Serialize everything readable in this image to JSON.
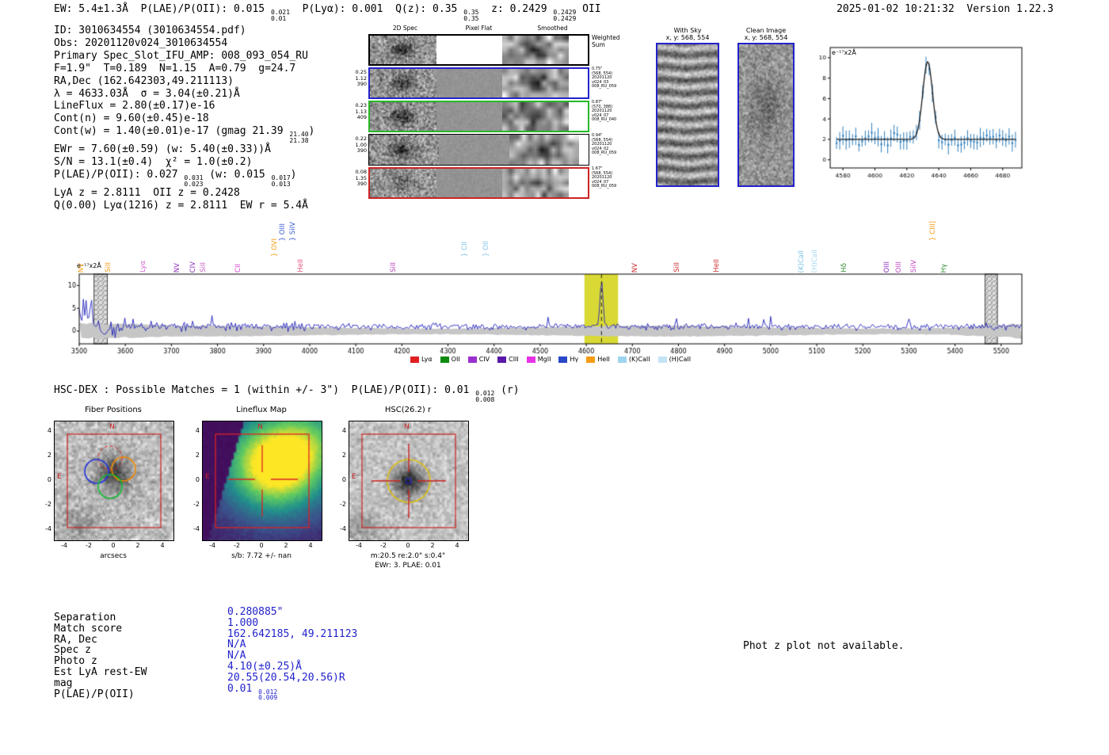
{
  "header": {
    "summary_line": "EW: 5.4±1.3Å  P(LAE)/P(OII): 0.015 {0.021|0.01}  P(Lyα): 0.001  Q(z): 0.35 {0.35|0.35}  z: 0.2429 {0.2429|0.2429} OII",
    "timestamp": "2025-01-02 10:21:32  Version 1.22.3"
  },
  "info_block": {
    "lines": [
      "ID: 3010634554 (3010634554.pdf)",
      "Obs: 20201120v024_3010634554",
      "Primary Spec_Slot_IFU_AMP: 008_093_054_RU",
      "F=1.9\"  T=0.189  N=1.15  A=0.79  g=24.7",
      "RA,Dec (162.642303,49.211113)",
      "λ = 4633.03Å  σ = 3.04(±0.21)Å",
      "LineFlux = 2.80(±0.17)e-16",
      "Cont(n) = 9.60(±0.45)e-18",
      "Cont(w) = 1.40(±0.01)e-17 (gmag 21.39 {21.40|21.38})",
      "EWr = 7.60(±0.59) (w: 5.40(±0.33))Å",
      "S/N = 13.1(±0.4)  χ² = 1.0(±0.2)",
      "P(LAE)/P(OII): 0.027 {0.031|0.023} (w: 0.015 {0.017|0.013})",
      "LyA z = 2.8111  OII z = 0.2428",
      "Q(0.00) Lyα(1216) z = 2.8111  EW r = 5.4Å"
    ]
  },
  "cutout_grid": {
    "column_titles": [
      "2D Spec",
      "Pixel Flat",
      "Smoothed"
    ],
    "rows": [
      {
        "left_values": [],
        "right_lines": [
          "Weighted",
          "Sum"
        ],
        "border": "#000000",
        "bw": 2
      },
      {
        "left_values": [
          "0.25",
          "1.12",
          "390"
        ],
        "right_lines": [
          "0.75\"",
          "(568, 554)",
          "20201120",
          "v024_03",
          "008_RU_059"
        ],
        "border": "#2323cc",
        "bw": 2
      },
      {
        "left_values": [
          "0.23",
          "1.13",
          "409"
        ],
        "right_lines": [
          "0.87\"",
          "(570, 388)",
          "20201120",
          "v024_07",
          "008_RU_040"
        ],
        "border": "#28b828",
        "bw": 2
      },
      {
        "left_values": [
          "0.22",
          "1.00",
          "390"
        ],
        "right_lines": [
          "0.94\"",
          "(568, 554)",
          "20201120",
          "v024_02",
          "008_RU_059"
        ],
        "border": "#000000",
        "bw": 1
      },
      {
        "left_values": [
          "0.08",
          "1.35",
          "390"
        ],
        "right_lines": [
          "1.67\"",
          "(568, 554)",
          "20201120",
          "v024_07",
          "008_RU_059"
        ],
        "border": "#cc2323",
        "bw": 2
      }
    ]
  },
  "sky_panels": [
    {
      "title": "With Sky",
      "subtitle": "x, y: 568, 554"
    },
    {
      "title": "Clean Image",
      "subtitle": "x, y: 568, 554"
    }
  ],
  "chart_data": [
    {
      "id": "line_fit_zoom",
      "type": "scatter",
      "ylabel_note": "e⁻¹⁷x2Å",
      "xlim": [
        4572,
        4692
      ],
      "ylim": [
        -0.8,
        11
      ],
      "xticks": [
        4580,
        4600,
        4620,
        4640,
        4660,
        4680
      ],
      "yticks": [
        0,
        2,
        4,
        6,
        8,
        10
      ],
      "fit": {
        "center": 4633.03,
        "sigma": 3.04,
        "amplitude": 7.6,
        "continuum": 2.0,
        "peak_value": 9.6
      },
      "point_color": "#2e7ebc",
      "fit_color": "#1a1a1a",
      "point_step": 2,
      "error_bar": 0.75
    },
    {
      "id": "full_spectrum",
      "type": "line",
      "ylabel_note": "e⁻¹⁷x2Å",
      "xlim": [
        3500,
        5545
      ],
      "ylim": [
        -2.8,
        12.5
      ],
      "xticks": [
        3500,
        3600,
        3700,
        3800,
        3900,
        4000,
        4100,
        4200,
        4300,
        4400,
        4500,
        4600,
        4700,
        4800,
        4900,
        5000,
        5100,
        5200,
        5300,
        5400,
        5500
      ],
      "yticks": [
        0,
        5,
        10
      ],
      "line_color": "#2121bb",
      "continuum": 0.95,
      "noise_sigma": 0.62,
      "blue_end_noise_sigma": 1.9,
      "emission_line": {
        "center": 4633.03,
        "amplitude": 10.2,
        "sigma": 3.2
      },
      "highlight_band": {
        "x0": 4596,
        "x1": 4669,
        "color": "#d7d72a"
      },
      "dashed_marker_x": 4633.03,
      "hatch_bands": [
        [
          3532,
          3561
        ],
        [
          5465,
          5492
        ]
      ],
      "error_band_halfwidth": 1.0,
      "line_markers": [
        {
          "label": "NV",
          "x": 3506,
          "color": "#f59b14",
          "tier": 0
        },
        {
          "label": "SiII",
          "x": 3563,
          "color": "#f59b14",
          "tier": 0
        },
        {
          "label": "Lyα",
          "x": 3640,
          "color": "#d65fd6",
          "tier": 0
        },
        {
          "label": "NV",
          "x": 3713,
          "color": "#8f2fbf",
          "tier": 0
        },
        {
          "label": "CIV",
          "x": 3747,
          "color": "#8f2fbf",
          "tier": 0
        },
        {
          "label": "SiII",
          "x": 3769,
          "color": "#c45fc4",
          "tier": 0
        },
        {
          "label": "CII",
          "x": 3846,
          "color": "#d643d6",
          "tier": 0
        },
        {
          "label": "} OVI",
          "x": 3924,
          "color": "#f59b14",
          "tier": 1
        },
        {
          "label": "} OIII",
          "x": 3942,
          "color": "#3b5bd6",
          "tier": 2
        },
        {
          "label": "} SiIV",
          "x": 3964,
          "color": "#3b5bd6",
          "tier": 2
        },
        {
          "label": "HeII",
          "x": 3981,
          "color": "#e0507a",
          "tier": 0
        },
        {
          "label": "SiII",
          "x": 4183,
          "color": "#b845b8",
          "tier": 0
        },
        {
          "label": "} CII",
          "x": 4337,
          "color": "#7fc4e8",
          "tier": 1
        },
        {
          "label": "} OII",
          "x": 4383,
          "color": "#7fc4e8",
          "tier": 1
        },
        {
          "label": "NV",
          "x": 4706,
          "color": "#cc2b2b",
          "tier": 0
        },
        {
          "label": "SiII",
          "x": 4798,
          "color": "#cc2b2b",
          "tier": 0
        },
        {
          "label": "HeII",
          "x": 4884,
          "color": "#cc2b2b",
          "tier": 0
        },
        {
          "label": "(K)CaII",
          "x": 5068,
          "color": "#7fc4e8",
          "tier": 0
        },
        {
          "label": "(H)CaII",
          "x": 5096,
          "color": "#a8d8ee",
          "tier": 0
        },
        {
          "label": "Hδ",
          "x": 5160,
          "color": "#2e8b2e",
          "tier": 0
        },
        {
          "label": "OIII",
          "x": 5253,
          "color": "#8f2fbf",
          "tier": 0
        },
        {
          "label": "OIII",
          "x": 5278,
          "color": "#c445c4",
          "tier": 0
        },
        {
          "label": "SiIV",
          "x": 5312,
          "color": "#c445c4",
          "tier": 0
        },
        {
          "label": "} CIII]",
          "x": 5352,
          "color": "#f59b14",
          "tier": 2
        },
        {
          "label": "Hγ",
          "x": 5376,
          "color": "#2e8b2e",
          "tier": 0
        }
      ],
      "legend": [
        {
          "label": "Lyα",
          "color": "#e02020"
        },
        {
          "label": "OII",
          "color": "#0f8a0f"
        },
        {
          "label": "CIV",
          "color": "#9a30d0"
        },
        {
          "label": "CIII",
          "color": "#5a18a8"
        },
        {
          "label": "MgII",
          "color": "#e832e8"
        },
        {
          "label": "Hγ",
          "color": "#2848c8"
        },
        {
          "label": "HeII",
          "color": "#f59b14"
        },
        {
          "label": "(K)CaII",
          "color": "#9fd4ef"
        },
        {
          "label": "(H)CaII",
          "color": "#c4e4f4"
        }
      ]
    }
  ],
  "hsc_section": {
    "header": "HSC-DEX : Possible Matches = 1 (within +/- 3\")  P(LAE)/P(OII): 0.01 {0.012|0.008} (r)",
    "axis_ticks": [
      -4,
      -2,
      0,
      2,
      4
    ],
    "compass": {
      "n": "N",
      "e": "E"
    },
    "panels": [
      {
        "title": "Fiber Positions",
        "xlabel": "arcsecs",
        "xlabel2": ""
      },
      {
        "title": "Lineflux Map",
        "xlabel": "s/b: 7.72 +/- nan",
        "xlabel2": ""
      },
      {
        "title": "HSC(26.2) r",
        "xlabel": "m:20.5 re:2.0\" s:0.4\"",
        "xlabel2": "EWr: 3. PLAE: 0.01"
      }
    ]
  },
  "match_table": {
    "value_color": "#2222cc",
    "rows": [
      {
        "label": "Separation",
        "value": "0.280885\""
      },
      {
        "label": "Match score",
        "value": "1.000"
      },
      {
        "label": "RA, Dec",
        "value": "162.642185, 49.211123"
      },
      {
        "label": "Spec z",
        "value": "N/A"
      },
      {
        "label": "Photo z",
        "value": "N/A"
      },
      {
        "label": "Est LyA rest-EW",
        "value": "4.10(±0.25)Å"
      },
      {
        "label": "mag",
        "value": "20.55(20.54,20.56)R"
      },
      {
        "label": "P(LAE)/P(OII)",
        "value": "0.01 {0.012|0.009}"
      }
    ]
  },
  "notes": {
    "photz": "Phot z plot not available."
  }
}
